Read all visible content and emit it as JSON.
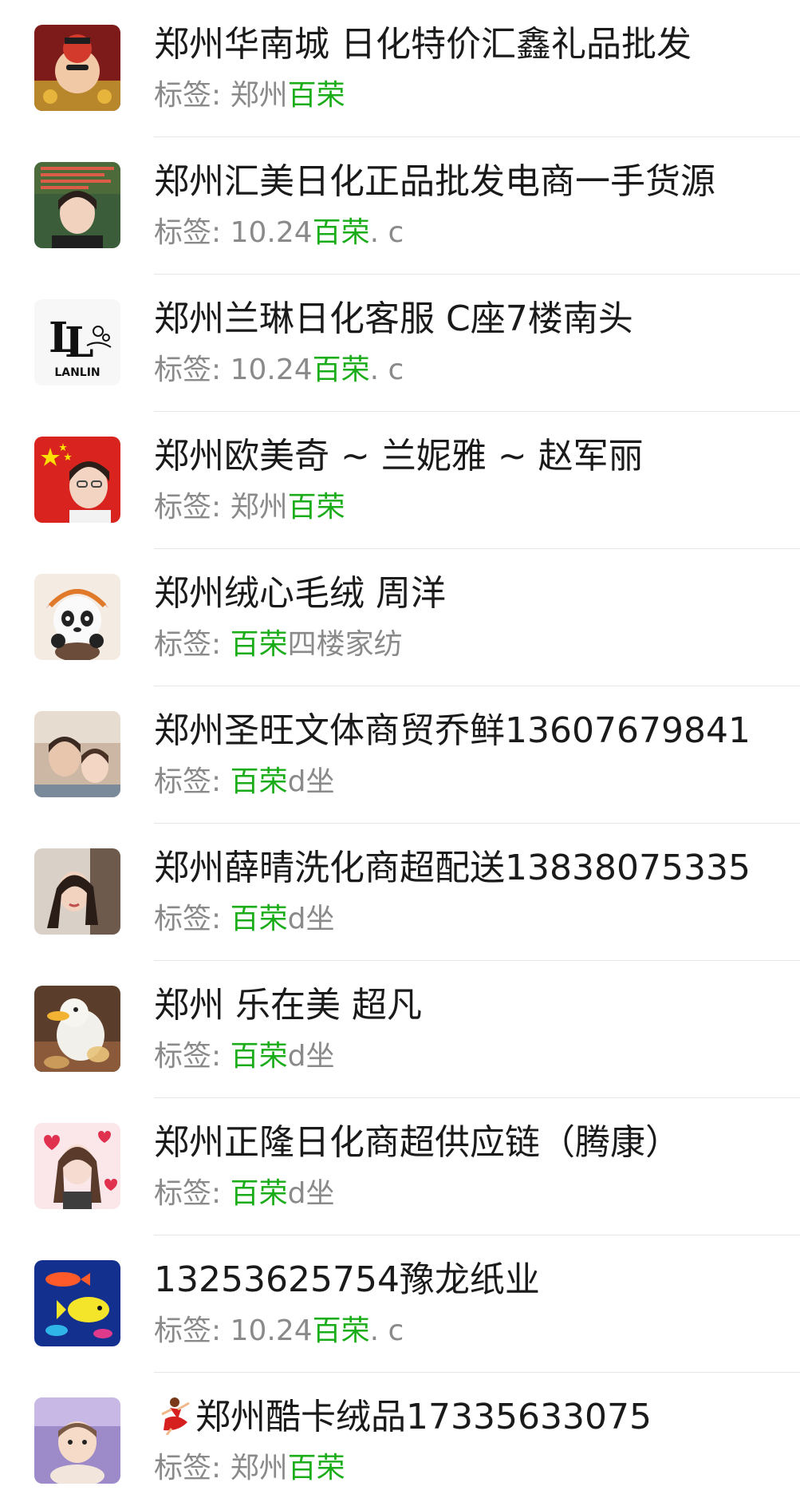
{
  "contacts": [
    {
      "name": "郑州华南城 日化特价汇鑫礼品批发",
      "tag_label": "标签: ",
      "tag_pre": "郑州",
      "tag_hl": "百荣",
      "tag_post": "",
      "avatar_icon": "lucky-mascot-avatar",
      "avatar_color": "#8b1e1e"
    },
    {
      "name": "郑州汇美日化正品批发电商一手货源",
      "tag_label": "标签: ",
      "tag_pre": "10.24",
      "tag_hl": "百荣",
      "tag_post": ". c",
      "avatar_icon": "woman-portrait-avatar",
      "avatar_color": "#3b5d3a"
    },
    {
      "name": "郑州兰琳日化客服 C座7楼南头",
      "tag_label": "标签: ",
      "tag_pre": "10.24",
      "tag_hl": "百荣",
      "tag_post": ". c",
      "avatar_icon": "lanlin-logo-avatar",
      "avatar_color": "#ffffff",
      "logo_text": "LANLIN"
    },
    {
      "name": "郑州欧美奇 ~ 兰妮雅 ~ 赵军丽",
      "tag_label": "标签: ",
      "tag_pre": "郑州",
      "tag_hl": "百荣",
      "tag_post": "",
      "avatar_icon": "flag-portrait-avatar",
      "avatar_color": "#d8231f"
    },
    {
      "name": "郑州绒心毛绒 周洋",
      "tag_label": "标签: ",
      "tag_pre": "",
      "tag_hl": "百荣",
      "tag_post": "四楼家纺",
      "avatar_icon": "panda-plush-avatar",
      "avatar_color": "#f2e6d6"
    },
    {
      "name": "郑州圣旺文体商贸乔鲜13607679841",
      "tag_label": "标签: ",
      "tag_pre": "",
      "tag_hl": "百荣",
      "tag_post": "d坐",
      "avatar_icon": "family-photo-avatar",
      "avatar_color": "#b89c86"
    },
    {
      "name": "郑州薛晴洗化商超配送13838075335",
      "tag_label": "标签: ",
      "tag_pre": "",
      "tag_hl": "百荣",
      "tag_post": "d坐",
      "avatar_icon": "woman-selfie-avatar",
      "avatar_color": "#9c7a66"
    },
    {
      "name": "郑州 乐在美  超凡",
      "tag_label": "标签: ",
      "tag_pre": "",
      "tag_hl": "百荣",
      "tag_post": "d坐",
      "avatar_icon": "duck-plush-avatar",
      "avatar_color": "#6b4a32"
    },
    {
      "name": "郑州正隆日化商超供应链（腾康）",
      "tag_label": "标签: ",
      "tag_pre": "",
      "tag_hl": "百荣",
      "tag_post": "d坐",
      "avatar_icon": "woman-hearts-avatar",
      "avatar_color": "#f4d9d9"
    },
    {
      "name": "13253625754豫龙纸业",
      "tag_label": "标签: ",
      "tag_pre": "10.24",
      "tag_hl": "百荣",
      "tag_post": ". c",
      "avatar_icon": "tropical-fish-avatar",
      "avatar_color": "#1d3fa8"
    },
    {
      "name": "郑州酷卡绒品17335633075",
      "name_prefix_icon": "dancer-emoji-icon",
      "tag_label": "标签: ",
      "tag_pre": "郑州",
      "tag_hl": "百荣",
      "tag_post": "",
      "avatar_icon": "baby-photo-avatar",
      "avatar_color": "#9a86c8"
    }
  ],
  "colors": {
    "tag_highlight": "#1aad19",
    "tag_text": "#8a8a8a",
    "name_text": "#1a1a1a",
    "divider": "#e6e6e6"
  }
}
